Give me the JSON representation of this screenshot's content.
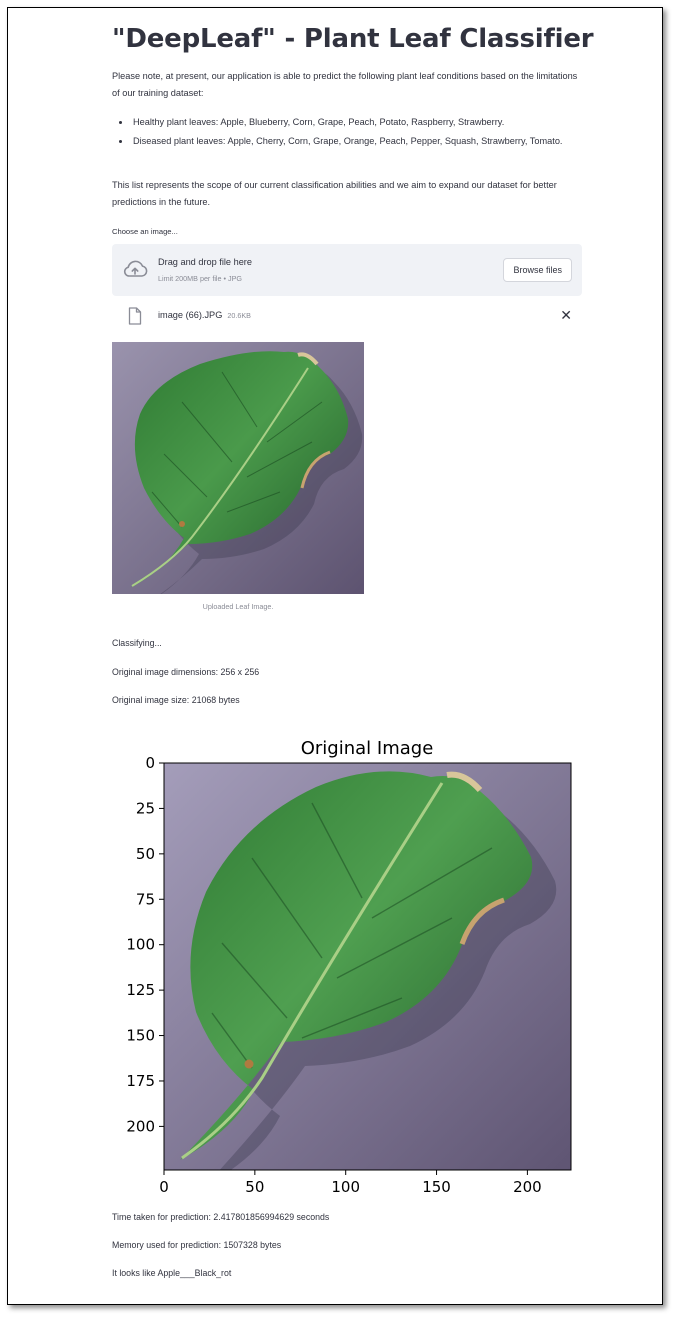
{
  "app": {
    "title": "\"DeepLeaf\" - Plant Leaf Classifier",
    "intro": "Please note, at present, our application is able to predict the following plant leaf conditions based on the limitations of our training dataset:",
    "leaf_lists": [
      "Healthy plant leaves: Apple, Blueberry, Corn, Grape, Peach, Potato, Raspberry, Strawberry.",
      "Diseased plant leaves: Apple, Cherry, Corn, Grape, Orange, Peach, Pepper, Squash, Strawberry, Tomato."
    ],
    "scope": "This list represents the scope of our current classification abilities and we aim to expand our dataset for better predictions in the future."
  },
  "uploader": {
    "label": "Choose an image...",
    "drag_text": "Drag and drop file here",
    "limit_text": "Limit 200MB per file • JPG",
    "browse_label": "Browse files",
    "close_glyph": "✕",
    "file": {
      "name": "image (66).JPG",
      "size": "20.6KB"
    }
  },
  "preview": {
    "caption": "Uploaded Leaf Image."
  },
  "status": {
    "classifying": "Classifying...",
    "dimensions": "Original image dimensions: 256 x 256",
    "size": "Original image size: 21068 bytes",
    "time": "Time taken for prediction: 2.417801856994629 seconds",
    "memory": "Memory used for prediction: 1507328 bytes",
    "result": "It looks like Apple___Black_rot"
  },
  "chart_data": {
    "type": "image",
    "title": "Original Image",
    "xlabel": "",
    "ylabel": "",
    "xlim": [
      0,
      224
    ],
    "ylim": [
      224,
      0
    ],
    "xticks": [
      0,
      50,
      100,
      150,
      200
    ],
    "yticks": [
      0,
      25,
      50,
      75,
      100,
      125,
      150,
      175,
      200
    ],
    "grid": false
  },
  "colors": {
    "text": "#31333f",
    "muted": "#8a8c96",
    "dropzone_bg": "#f0f2f6",
    "leaf_dark": "#1e5b25",
    "leaf_mid": "#3a8a3c",
    "background_purple": "#8e86a4"
  },
  "icons": {
    "upload": "cloud-upload-icon",
    "file": "file-icon",
    "close": "close-icon"
  }
}
